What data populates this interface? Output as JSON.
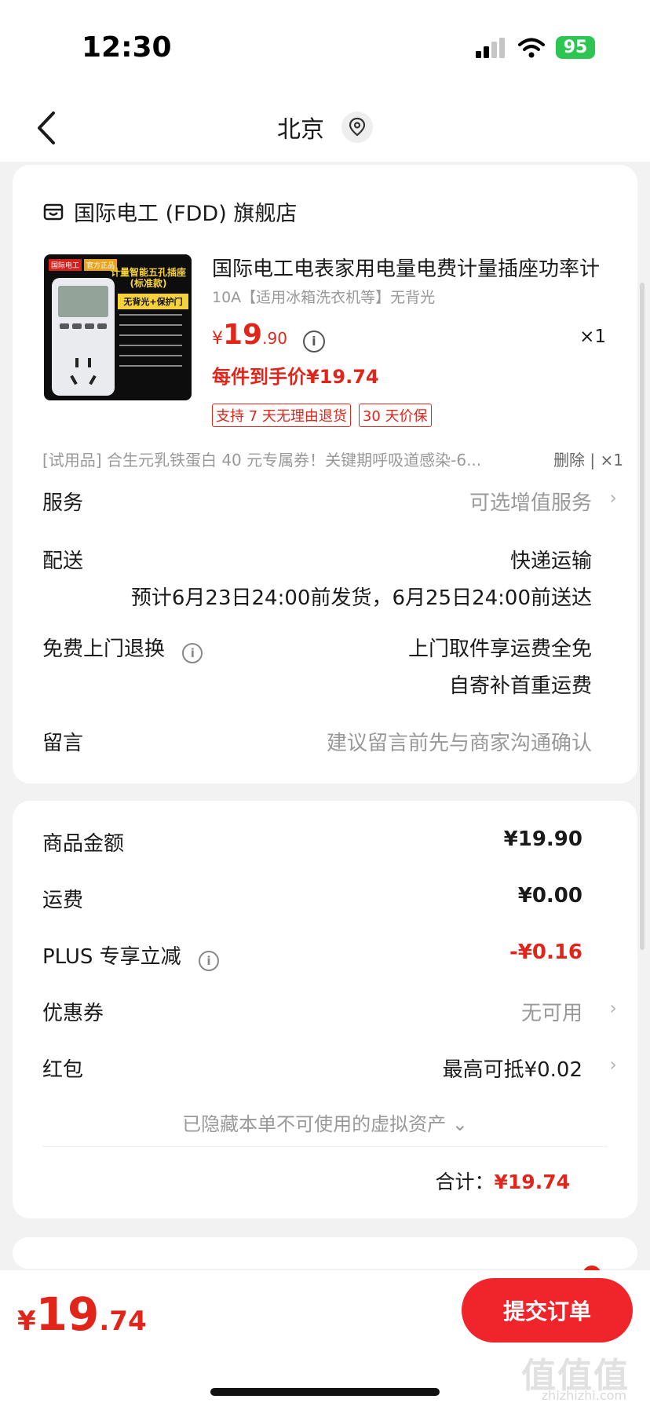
{
  "status_bar": {
    "time": "12:30",
    "battery": "95"
  },
  "nav": {
    "title": "北京"
  },
  "store": {
    "name": "国际电工 (FDD) 旗舰店"
  },
  "product": {
    "image_labels": {
      "tag1": "国际电工",
      "tag2": "官方正品",
      "headline": "计量智能五孔插座 (标准款)",
      "banner": "无背光+保护门"
    },
    "title": "国际电工电表家用电量电费计量插座功率计",
    "spec": "10A【适用冰箱洗衣机等】无背光",
    "price_symbol": "¥",
    "price_int": "19",
    "price_dec": ".90",
    "quantity": "×1",
    "net_price": "每件到手价¥19.74",
    "tags": [
      "支持 7 天无理由退货",
      "30 天价保"
    ]
  },
  "gift": {
    "text": "[试用品] 合生元乳铁蛋白 40 元专属券！关键期呼吸道感染-6...",
    "action": "删除 | ×1"
  },
  "service": {
    "label": "服务",
    "value": "可选增值服务"
  },
  "delivery": {
    "label": "配送",
    "method": "快递运输",
    "estimate": "预计6月23日24:00前发货，6月25日24:00前送达"
  },
  "returns": {
    "label": "免费上门退换",
    "line1": "上门取件享运费全免",
    "line2": "自寄补首重运费"
  },
  "message": {
    "label": "留言",
    "placeholder": "建议留言前先与商家沟通确认"
  },
  "summary": {
    "goods_label": "商品金额",
    "goods_value": "¥19.90",
    "shipping_label": "运费",
    "shipping_value": "¥0.00",
    "plus_label": "PLUS 专享立减",
    "plus_value": "-¥0.16",
    "coupon_label": "优惠券",
    "coupon_value": "无可用",
    "redpacket_label": "红包",
    "redpacket_value": "最高可抵¥0.02",
    "hidden_assets": "已隐藏本单不可使用的虚拟资产 ⌄",
    "total_label": "合计：",
    "total_value": "¥19.74"
  },
  "bottom": {
    "price_symbol": "¥",
    "price_int": "19",
    "price_dec": ".74",
    "submit": "提交订单"
  },
  "watermark": {
    "main": "值值值",
    "sub": "zhizhizhi.com"
  }
}
